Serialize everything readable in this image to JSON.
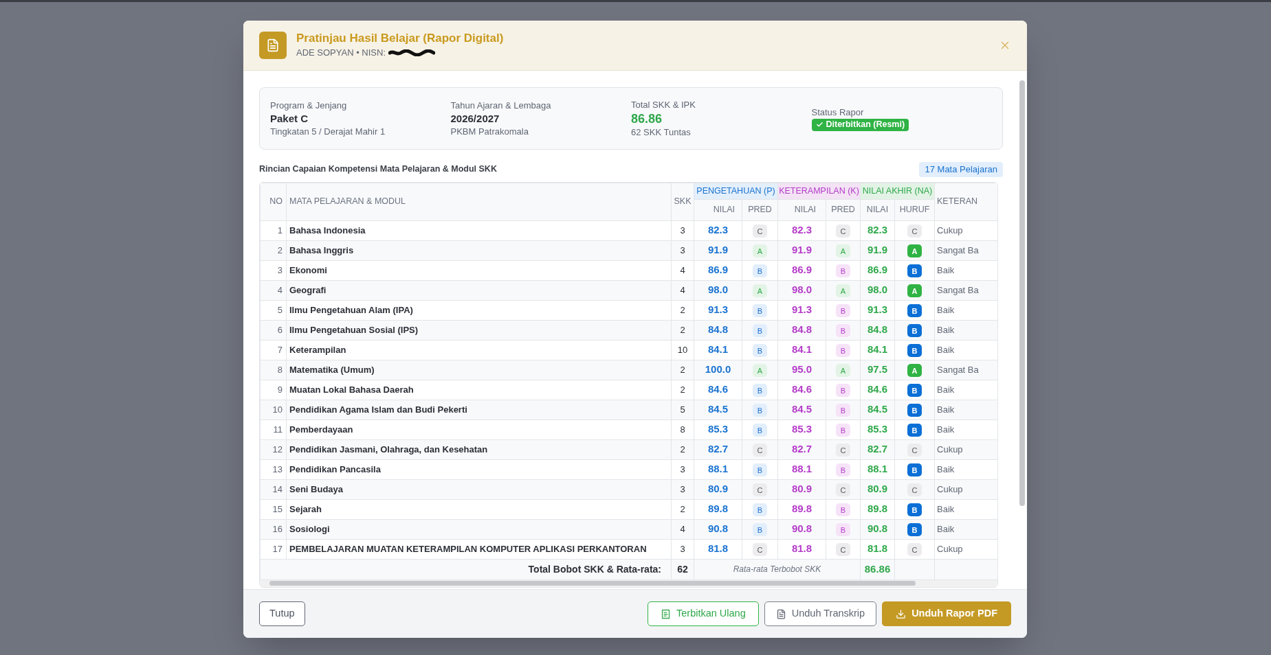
{
  "modal": {
    "title": "Pratinjau Hasil Belajar (Rapor Digital)",
    "subtitle": "ADE SOPYAN • NISN:"
  },
  "summary": [
    {
      "kind": "text",
      "label": "Program & Jenjang",
      "value": "Paket C",
      "detail": "Tingkatan 5 / Derajat Mahir 1"
    },
    {
      "kind": "text",
      "label": "Tahun Ajaran & Lembaga",
      "value": "2026/2027",
      "detail": "PKBM Patrakomala"
    },
    {
      "kind": "score",
      "label": "Total SKK & IPK",
      "value": "86.86",
      "detail": "62 SKK Tuntas"
    },
    {
      "kind": "status",
      "label": "Status Rapor",
      "value": "Diterbitkan (Resmi)"
    }
  ],
  "section": {
    "title": "Rincian Capaian Kompetensi Mata Pelajaran & Modul SKK",
    "count": "17 Mata Pelajaran"
  },
  "table": {
    "columns": {
      "no": "NO",
      "subject": "MATA PELAJARAN & MODUL",
      "skk": "SKK",
      "knowledge": "PENGETAHUAN (P)",
      "skill": "KETERAMPILAN (K)",
      "final": "NILAI AKHIR (NA)",
      "note": "KETERAN",
      "knowledge_score": "NILAI",
      "knowledge_pred": "PRED",
      "skill_score": "NILAI",
      "skill_pred": "PRED",
      "final_score": "NILAI",
      "final_letter": "HURUF"
    },
    "rows": [
      {
        "no": "1",
        "subject": "Bahasa Indonesia",
        "skk": "3",
        "p": "82.3",
        "p_pred": "C",
        "k": "82.3",
        "k_pred": "C",
        "na": "82.3",
        "letter": "C",
        "note": "Cukup",
        "kind": "fair"
      },
      {
        "no": "2",
        "subject": "Bahasa Inggris",
        "skk": "3",
        "p": "91.9",
        "p_pred": "A",
        "k": "91.9",
        "k_pred": "A",
        "na": "91.9",
        "letter": "A",
        "note": "Sangat Ba",
        "kind": "excellent"
      },
      {
        "no": "3",
        "subject": "Ekonomi",
        "skk": "4",
        "p": "86.9",
        "p_pred": "B",
        "k": "86.9",
        "k_pred": "B",
        "na": "86.9",
        "letter": "B",
        "note": "Baik",
        "kind": "good"
      },
      {
        "no": "4",
        "subject": "Geografi",
        "skk": "4",
        "p": "98.0",
        "p_pred": "A",
        "k": "98.0",
        "k_pred": "A",
        "na": "98.0",
        "letter": "A",
        "note": "Sangat Ba",
        "kind": "excellent"
      },
      {
        "no": "5",
        "subject": "Ilmu Pengetahuan Alam (IPA)",
        "skk": "2",
        "p": "91.3",
        "p_pred": "B",
        "k": "91.3",
        "k_pred": "B",
        "na": "91.3",
        "letter": "B",
        "note": "Baik",
        "kind": "good"
      },
      {
        "no": "6",
        "subject": "Ilmu Pengetahuan Sosial (IPS)",
        "skk": "2",
        "p": "84.8",
        "p_pred": "B",
        "k": "84.8",
        "k_pred": "B",
        "na": "84.8",
        "letter": "B",
        "note": "Baik",
        "kind": "good"
      },
      {
        "no": "7",
        "subject": "Keterampilan",
        "skk": "10",
        "p": "84.1",
        "p_pred": "B",
        "k": "84.1",
        "k_pred": "B",
        "na": "84.1",
        "letter": "B",
        "note": "Baik",
        "kind": "good"
      },
      {
        "no": "8",
        "subject": "Matematika (Umum)",
        "skk": "2",
        "p": "100.0",
        "p_pred": "A",
        "k": "95.0",
        "k_pred": "A",
        "na": "97.5",
        "letter": "A",
        "note": "Sangat Ba",
        "kind": "excellent"
      },
      {
        "no": "9",
        "subject": "Muatan Lokal Bahasa Daerah",
        "skk": "2",
        "p": "84.6",
        "p_pred": "B",
        "k": "84.6",
        "k_pred": "B",
        "na": "84.6",
        "letter": "B",
        "note": "Baik",
        "kind": "good"
      },
      {
        "no": "10",
        "subject": "Pendidikan Agama Islam dan Budi Pekerti",
        "skk": "5",
        "p": "84.5",
        "p_pred": "B",
        "k": "84.5",
        "k_pred": "B",
        "na": "84.5",
        "letter": "B",
        "note": "Baik",
        "kind": "good"
      },
      {
        "no": "11",
        "subject": "Pemberdayaan",
        "skk": "8",
        "p": "85.3",
        "p_pred": "B",
        "k": "85.3",
        "k_pred": "B",
        "na": "85.3",
        "letter": "B",
        "note": "Baik",
        "kind": "good"
      },
      {
        "no": "12",
        "subject": "Pendidikan Jasmani, Olahraga, dan Kesehatan",
        "skk": "2",
        "p": "82.7",
        "p_pred": "C",
        "k": "82.7",
        "k_pred": "C",
        "na": "82.7",
        "letter": "C",
        "note": "Cukup",
        "kind": "fair"
      },
      {
        "no": "13",
        "subject": "Pendidikan Pancasila",
        "skk": "3",
        "p": "88.1",
        "p_pred": "B",
        "k": "88.1",
        "k_pred": "B",
        "na": "88.1",
        "letter": "B",
        "note": "Baik",
        "kind": "good"
      },
      {
        "no": "14",
        "subject": "Seni Budaya",
        "skk": "3",
        "p": "80.9",
        "p_pred": "C",
        "k": "80.9",
        "k_pred": "C",
        "na": "80.9",
        "letter": "C",
        "note": "Cukup",
        "kind": "fair"
      },
      {
        "no": "15",
        "subject": "Sejarah",
        "skk": "2",
        "p": "89.8",
        "p_pred": "B",
        "k": "89.8",
        "k_pred": "B",
        "na": "89.8",
        "letter": "B",
        "note": "Baik",
        "kind": "good"
      },
      {
        "no": "16",
        "subject": "Sosiologi",
        "skk": "4",
        "p": "90.8",
        "p_pred": "B",
        "k": "90.8",
        "k_pred": "B",
        "na": "90.8",
        "letter": "B",
        "note": "Baik",
        "kind": "good"
      },
      {
        "no": "17",
        "subject": "PEMBELAJARAN MUATAN KETERAMPILAN KOMPUTER APLIKASI PERKANTORAN",
        "skk": "3",
        "p": "81.8",
        "p_pred": "C",
        "k": "81.8",
        "k_pred": "C",
        "na": "81.8",
        "letter": "C",
        "note": "Cukup",
        "kind": "fair"
      }
    ],
    "total": {
      "label": "Total Bobot SKK & Rata-rata:",
      "skk": "62",
      "note": "Rata-rata Terbobot SKK",
      "average": "86.86"
    }
  },
  "buttons": [
    {
      "kind": "close",
      "label": "Tutup"
    },
    {
      "kind": "reissue",
      "label": "Terbitkan Ulang"
    },
    {
      "kind": "transcript",
      "label": "Unduh Transkrip"
    },
    {
      "kind": "download",
      "label": "Unduh Rapor PDF"
    }
  ]
}
